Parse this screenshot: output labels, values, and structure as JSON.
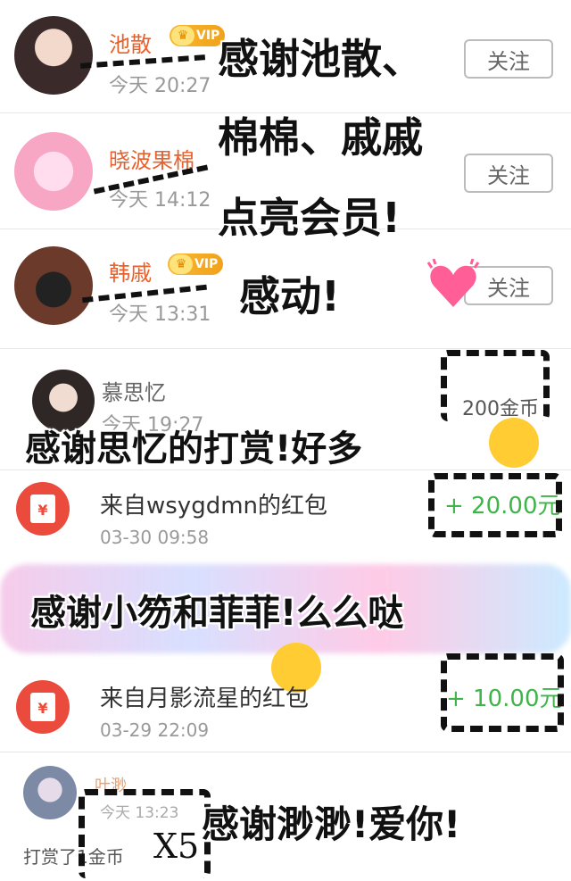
{
  "follow_list": [
    {
      "name": "池散",
      "vip": "VIP",
      "time": "今天 20:27",
      "follow": "关注"
    },
    {
      "name": "晓波果棉",
      "time": "今天 14:12",
      "follow": "关注"
    },
    {
      "name": "韩戚",
      "vip": "VIP",
      "time": "今天 13:31",
      "follow": "关注"
    }
  ],
  "reward_item": {
    "name": "慕思忆",
    "time": "今天 19:27",
    "coins": "200金币"
  },
  "red_packets": [
    {
      "title": "来自wsygdmn的红包",
      "time": "03-30 09:58",
      "amount": "+ 20.00元"
    },
    {
      "title": "来自月影流星的红包",
      "time": "03-29 22:09",
      "amount": "+ 10.00元"
    }
  ],
  "last_item": {
    "name": "叶渺",
    "time": "今天 13:23",
    "text": "打赏了1金币"
  },
  "captions": {
    "c1": "感谢池散、",
    "c2": "棉棉、戚戚",
    "c3": "点亮会员!",
    "c4": "感动!",
    "c5": "感谢思忆的打赏!好多",
    "c6": "感谢小笏和菲菲!么么哒",
    "c7": "感谢渺渺!爱你!",
    "x5": "X5"
  },
  "colors": {
    "accent": "#e8612c",
    "vip": "#f1a21a",
    "green": "#3fb44a",
    "red": "#ea4b3d"
  }
}
